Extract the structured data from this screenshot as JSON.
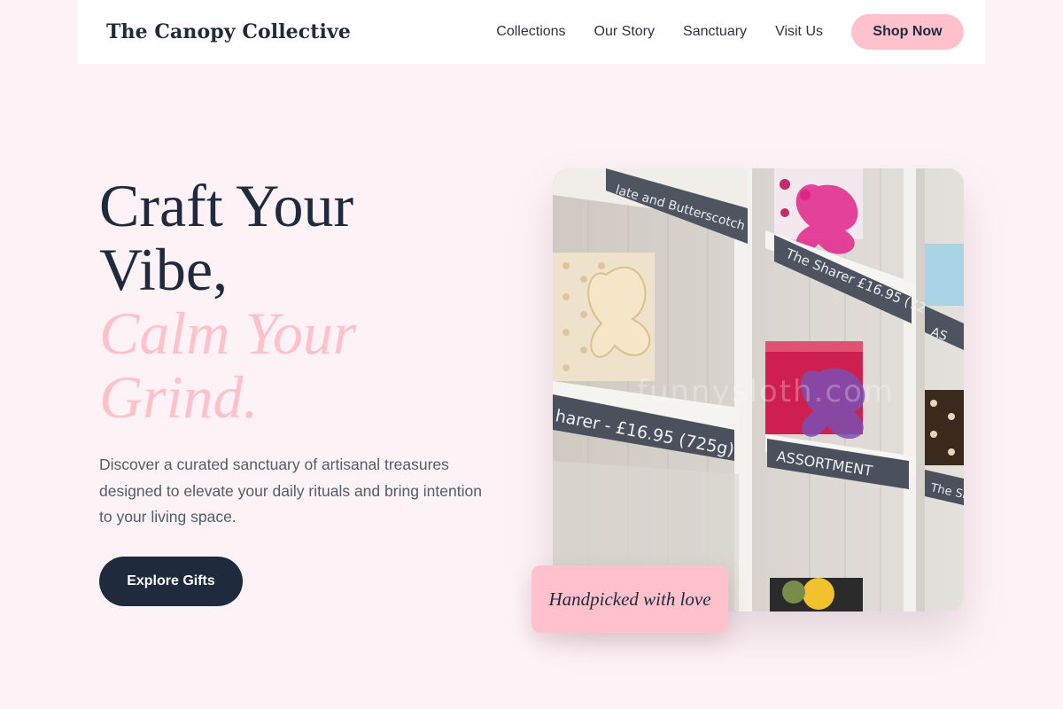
{
  "brand": {
    "name": "The Canopy Collective"
  },
  "nav": {
    "items": [
      "Collections",
      "Our Story",
      "Sanctuary",
      "Visit Us"
    ],
    "cta_label": "Shop Now"
  },
  "hero": {
    "title_line1": "Craft Your",
    "title_line2": "Vibe,",
    "title_accent_line1": "Calm Your",
    "title_accent_line2": "Grind.",
    "description": "Discover a curated sanctuary of artisanal treasures designed to elevate your daily rituals and bring intention to your living space.",
    "button_label": "Explore Gifts",
    "image_badge": "Handpicked with love"
  },
  "photo": {
    "shelf_labels": [
      "late and Butterscotch",
      "The Sharer £16.95 (72",
      "AS",
      "harer - £16.95 (725g)",
      "ASSORTMENT",
      "The Sh"
    ],
    "watermark": "funnysloth.com"
  },
  "colors": {
    "accent": "#ffc2cc",
    "dark": "#1f2a3d",
    "background": "#fdf3f6"
  }
}
